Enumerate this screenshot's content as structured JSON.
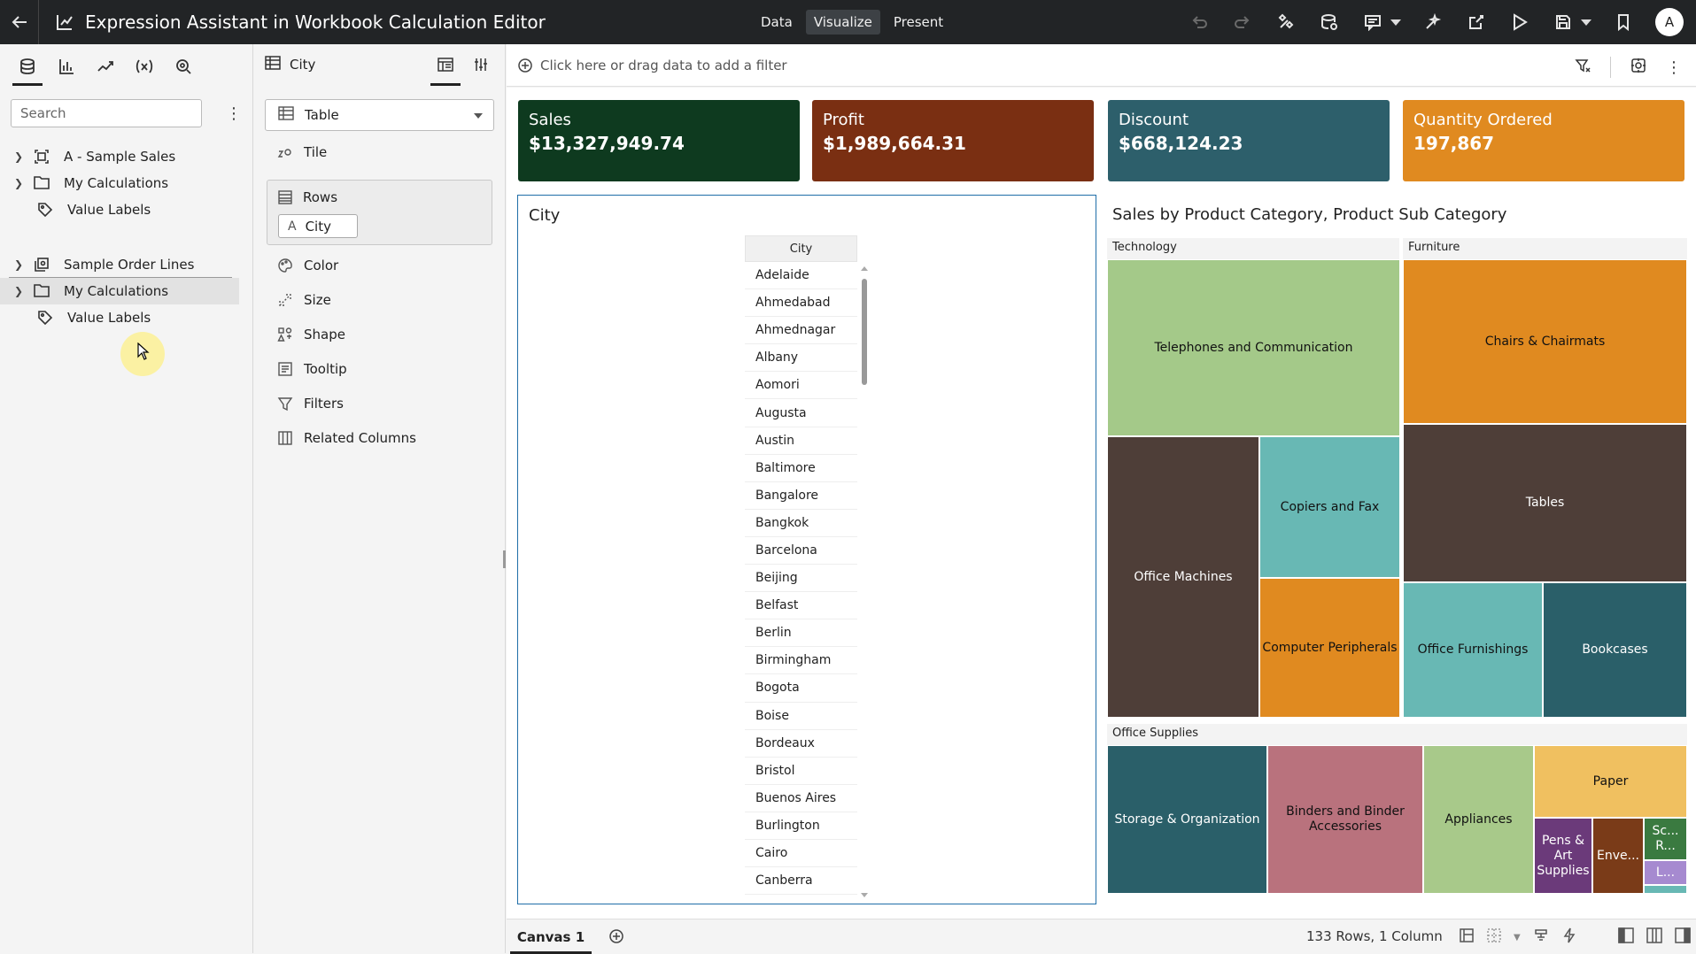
{
  "header": {
    "title": "Expression Assistant in Workbook Calculation Editor",
    "modes": [
      "Data",
      "Visualize",
      "Present"
    ],
    "active_mode": "Visualize",
    "avatar_initial": "A"
  },
  "data_panel": {
    "search_placeholder": "Search",
    "tree": [
      {
        "label": "A - Sample Sales",
        "icon": "subject-area-icon",
        "type": "source"
      },
      {
        "label": "My Calculations",
        "icon": "folder-icon",
        "type": "folder"
      },
      {
        "label": "Value Labels",
        "icon": "tag-icon",
        "type": "leaf"
      }
    ],
    "tree2": [
      {
        "label": "Sample Order Lines",
        "icon": "dataset-icon",
        "type": "source"
      },
      {
        "label": "My Calculations",
        "icon": "folder-icon",
        "type": "folder",
        "selected": true
      },
      {
        "label": "Value Labels",
        "icon": "tag-icon",
        "type": "leaf"
      }
    ]
  },
  "grammar_panel": {
    "viz_name": "City",
    "viz_type": "Table",
    "tile_label": "Tile",
    "rows_label": "Rows",
    "rows_pill": "City",
    "items": [
      "Color",
      "Size",
      "Shape",
      "Tooltip",
      "Filters",
      "Related Columns"
    ]
  },
  "filter_bar": {
    "placeholder": "Click here or drag data to add a filter"
  },
  "tiles": [
    {
      "label": "Sales",
      "value": "$13,327,949.74",
      "color": "#0e3a1f"
    },
    {
      "label": "Profit",
      "value": "$1,989,664.31",
      "color": "#7a2f12"
    },
    {
      "label": "Discount",
      "value": "$668,124.23",
      "color": "#2d5f6b"
    },
    {
      "label": "Quantity Ordered",
      "value": "197,867",
      "color": "#e08a20"
    }
  ],
  "city_table": {
    "title": "City",
    "column": "City",
    "rows": [
      "Adelaide",
      "Ahmedabad",
      "Ahmednagar",
      "Albany",
      "Aomori",
      "Augusta",
      "Austin",
      "Baltimore",
      "Bangalore",
      "Bangkok",
      "Barcelona",
      "Beijing",
      "Belfast",
      "Berlin",
      "Birmingham",
      "Bogota",
      "Boise",
      "Bordeaux",
      "Bristol",
      "Buenos Aires",
      "Burlington",
      "Cairo",
      "Canberra"
    ]
  },
  "treemap": {
    "title": "Sales by Product Category, Product Sub Category",
    "groups": [
      "Technology",
      "Furniture",
      "Office Supplies"
    ],
    "cells": {
      "telephones": "Telephones and Communication",
      "office_machines": "Office Machines",
      "copiers": "Copiers and Fax",
      "computer_peripherals": "Computer Peripherals",
      "chairs": "Chairs & Chairmats",
      "tables": "Tables",
      "office_furnishings": "Office Furnishings",
      "bookcases": "Bookcases",
      "storage": "Storage & Organization",
      "binders": "Binders and Binder Accessories",
      "appliances": "Appliances",
      "paper": "Paper",
      "pens": "Pens & Art Supplies",
      "envelopes": "Enve...",
      "scissors": "Sc... R...",
      "labels": "L..."
    },
    "colors": {
      "light_green": "#a4c989",
      "dark_brown": "#4e3e38",
      "teal": "#68b8b4",
      "orange": "#e08a20",
      "dark_teal": "#2a5f69",
      "pink": "#b9727d",
      "sage": "#a8c98a",
      "gold": "#f0c060",
      "purple": "#6b3a7a",
      "rust": "#7a3b18",
      "green": "#3a7a40",
      "lilac": "#a68ad0"
    }
  },
  "bottom_bar": {
    "canvas_tab": "Canvas 1",
    "status": "133 Rows, 1 Column"
  }
}
